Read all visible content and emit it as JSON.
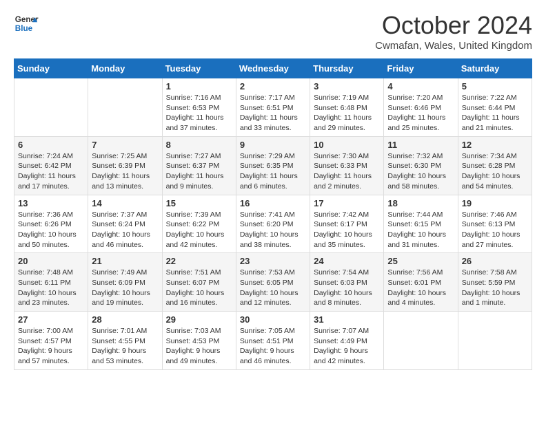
{
  "header": {
    "logo_line1": "General",
    "logo_line2": "Blue",
    "title": "October 2024",
    "subtitle": "Cwmafan, Wales, United Kingdom"
  },
  "weekdays": [
    "Sunday",
    "Monday",
    "Tuesday",
    "Wednesday",
    "Thursday",
    "Friday",
    "Saturday"
  ],
  "weeks": [
    [
      {
        "day": "",
        "sunrise": "",
        "sunset": "",
        "daylight": ""
      },
      {
        "day": "",
        "sunrise": "",
        "sunset": "",
        "daylight": ""
      },
      {
        "day": "1",
        "sunrise": "Sunrise: 7:16 AM",
        "sunset": "Sunset: 6:53 PM",
        "daylight": "Daylight: 11 hours and 37 minutes."
      },
      {
        "day": "2",
        "sunrise": "Sunrise: 7:17 AM",
        "sunset": "Sunset: 6:51 PM",
        "daylight": "Daylight: 11 hours and 33 minutes."
      },
      {
        "day": "3",
        "sunrise": "Sunrise: 7:19 AM",
        "sunset": "Sunset: 6:48 PM",
        "daylight": "Daylight: 11 hours and 29 minutes."
      },
      {
        "day": "4",
        "sunrise": "Sunrise: 7:20 AM",
        "sunset": "Sunset: 6:46 PM",
        "daylight": "Daylight: 11 hours and 25 minutes."
      },
      {
        "day": "5",
        "sunrise": "Sunrise: 7:22 AM",
        "sunset": "Sunset: 6:44 PM",
        "daylight": "Daylight: 11 hours and 21 minutes."
      }
    ],
    [
      {
        "day": "6",
        "sunrise": "Sunrise: 7:24 AM",
        "sunset": "Sunset: 6:42 PM",
        "daylight": "Daylight: 11 hours and 17 minutes."
      },
      {
        "day": "7",
        "sunrise": "Sunrise: 7:25 AM",
        "sunset": "Sunset: 6:39 PM",
        "daylight": "Daylight: 11 hours and 13 minutes."
      },
      {
        "day": "8",
        "sunrise": "Sunrise: 7:27 AM",
        "sunset": "Sunset: 6:37 PM",
        "daylight": "Daylight: 11 hours and 9 minutes."
      },
      {
        "day": "9",
        "sunrise": "Sunrise: 7:29 AM",
        "sunset": "Sunset: 6:35 PM",
        "daylight": "Daylight: 11 hours and 6 minutes."
      },
      {
        "day": "10",
        "sunrise": "Sunrise: 7:30 AM",
        "sunset": "Sunset: 6:33 PM",
        "daylight": "Daylight: 11 hours and 2 minutes."
      },
      {
        "day": "11",
        "sunrise": "Sunrise: 7:32 AM",
        "sunset": "Sunset: 6:30 PM",
        "daylight": "Daylight: 10 hours and 58 minutes."
      },
      {
        "day": "12",
        "sunrise": "Sunrise: 7:34 AM",
        "sunset": "Sunset: 6:28 PM",
        "daylight": "Daylight: 10 hours and 54 minutes."
      }
    ],
    [
      {
        "day": "13",
        "sunrise": "Sunrise: 7:36 AM",
        "sunset": "Sunset: 6:26 PM",
        "daylight": "Daylight: 10 hours and 50 minutes."
      },
      {
        "day": "14",
        "sunrise": "Sunrise: 7:37 AM",
        "sunset": "Sunset: 6:24 PM",
        "daylight": "Daylight: 10 hours and 46 minutes."
      },
      {
        "day": "15",
        "sunrise": "Sunrise: 7:39 AM",
        "sunset": "Sunset: 6:22 PM",
        "daylight": "Daylight: 10 hours and 42 minutes."
      },
      {
        "day": "16",
        "sunrise": "Sunrise: 7:41 AM",
        "sunset": "Sunset: 6:20 PM",
        "daylight": "Daylight: 10 hours and 38 minutes."
      },
      {
        "day": "17",
        "sunrise": "Sunrise: 7:42 AM",
        "sunset": "Sunset: 6:17 PM",
        "daylight": "Daylight: 10 hours and 35 minutes."
      },
      {
        "day": "18",
        "sunrise": "Sunrise: 7:44 AM",
        "sunset": "Sunset: 6:15 PM",
        "daylight": "Daylight: 10 hours and 31 minutes."
      },
      {
        "day": "19",
        "sunrise": "Sunrise: 7:46 AM",
        "sunset": "Sunset: 6:13 PM",
        "daylight": "Daylight: 10 hours and 27 minutes."
      }
    ],
    [
      {
        "day": "20",
        "sunrise": "Sunrise: 7:48 AM",
        "sunset": "Sunset: 6:11 PM",
        "daylight": "Daylight: 10 hours and 23 minutes."
      },
      {
        "day": "21",
        "sunrise": "Sunrise: 7:49 AM",
        "sunset": "Sunset: 6:09 PM",
        "daylight": "Daylight: 10 hours and 19 minutes."
      },
      {
        "day": "22",
        "sunrise": "Sunrise: 7:51 AM",
        "sunset": "Sunset: 6:07 PM",
        "daylight": "Daylight: 10 hours and 16 minutes."
      },
      {
        "day": "23",
        "sunrise": "Sunrise: 7:53 AM",
        "sunset": "Sunset: 6:05 PM",
        "daylight": "Daylight: 10 hours and 12 minutes."
      },
      {
        "day": "24",
        "sunrise": "Sunrise: 7:54 AM",
        "sunset": "Sunset: 6:03 PM",
        "daylight": "Daylight: 10 hours and 8 minutes."
      },
      {
        "day": "25",
        "sunrise": "Sunrise: 7:56 AM",
        "sunset": "Sunset: 6:01 PM",
        "daylight": "Daylight: 10 hours and 4 minutes."
      },
      {
        "day": "26",
        "sunrise": "Sunrise: 7:58 AM",
        "sunset": "Sunset: 5:59 PM",
        "daylight": "Daylight: 10 hours and 1 minute."
      }
    ],
    [
      {
        "day": "27",
        "sunrise": "Sunrise: 7:00 AM",
        "sunset": "Sunset: 4:57 PM",
        "daylight": "Daylight: 9 hours and 57 minutes."
      },
      {
        "day": "28",
        "sunrise": "Sunrise: 7:01 AM",
        "sunset": "Sunset: 4:55 PM",
        "daylight": "Daylight: 9 hours and 53 minutes."
      },
      {
        "day": "29",
        "sunrise": "Sunrise: 7:03 AM",
        "sunset": "Sunset: 4:53 PM",
        "daylight": "Daylight: 9 hours and 49 minutes."
      },
      {
        "day": "30",
        "sunrise": "Sunrise: 7:05 AM",
        "sunset": "Sunset: 4:51 PM",
        "daylight": "Daylight: 9 hours and 46 minutes."
      },
      {
        "day": "31",
        "sunrise": "Sunrise: 7:07 AM",
        "sunset": "Sunset: 4:49 PM",
        "daylight": "Daylight: 9 hours and 42 minutes."
      },
      {
        "day": "",
        "sunrise": "",
        "sunset": "",
        "daylight": ""
      },
      {
        "day": "",
        "sunrise": "",
        "sunset": "",
        "daylight": ""
      }
    ]
  ]
}
